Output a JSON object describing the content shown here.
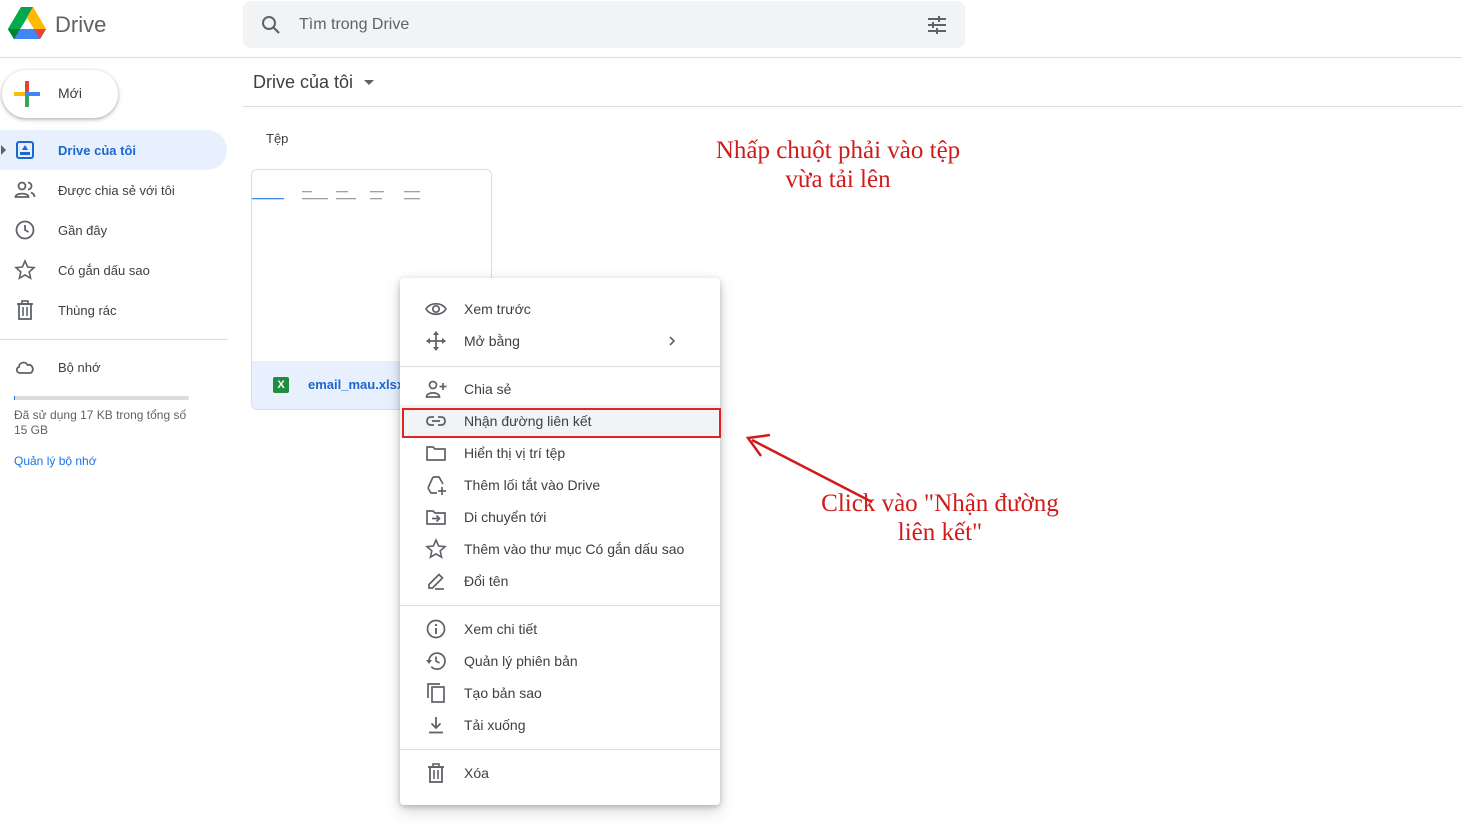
{
  "app": {
    "name": "Drive"
  },
  "search": {
    "placeholder": "Tìm trong Drive"
  },
  "sidebar": {
    "new_label": "Mới",
    "items": [
      {
        "label": "Drive của tôi",
        "icon": "my-drive-icon",
        "active": true
      },
      {
        "label": "Được chia sẻ với tôi",
        "icon": "shared-people-icon",
        "active": false
      },
      {
        "label": "Gần đây",
        "icon": "clock-icon",
        "active": false
      },
      {
        "label": "Có gắn dấu sao",
        "icon": "star-icon",
        "active": false
      },
      {
        "label": "Thùng rác",
        "icon": "trash-icon",
        "active": false
      }
    ],
    "storage": {
      "label": "Bộ nhớ",
      "used_fraction": 0.001,
      "usage_text": "Đã sử dụng 17 KB trong tổng số 15 GB",
      "manage_link": "Quản lý bộ nhớ"
    }
  },
  "main": {
    "breadcrumb": "Drive của tôi",
    "section_label": "Tệp",
    "file": {
      "name": "email_mau.xlsx",
      "type_badge": "X"
    }
  },
  "context_menu": {
    "groups": [
      [
        {
          "label": "Xem trước",
          "icon": "eye-icon"
        },
        {
          "label": "Mở bằng",
          "icon": "move-arrows-icon",
          "submenu": true
        }
      ],
      [
        {
          "label": "Chia sẻ",
          "icon": "add-person-icon"
        },
        {
          "label": "Nhận đường liên kết",
          "icon": "link-icon",
          "highlighted": true
        },
        {
          "label": "Hiển thị vị trí tệp",
          "icon": "folder-icon"
        },
        {
          "label": "Thêm lối tắt vào Drive",
          "icon": "add-shortcut-icon"
        },
        {
          "label": "Di chuyển tới",
          "icon": "move-to-folder-icon"
        },
        {
          "label": "Thêm vào thư mục Có gắn dấu sao",
          "icon": "star-icon"
        },
        {
          "label": "Đổi tên",
          "icon": "pencil-icon"
        }
      ],
      [
        {
          "label": "Xem chi tiết",
          "icon": "info-icon"
        },
        {
          "label": "Quản lý phiên bản",
          "icon": "history-icon"
        },
        {
          "label": "Tạo bản sao",
          "icon": "copy-icon"
        },
        {
          "label": "Tải xuống",
          "icon": "download-icon"
        }
      ],
      [
        {
          "label": "Xóa",
          "icon": "trash-icon"
        }
      ]
    ]
  },
  "annotations": {
    "note1": "Nhấp chuột phải vào tệp vừa tải lên",
    "note2": "Click vào \"Nhận đường liên kết\"",
    "color": "#d11b1b"
  },
  "colors": {
    "accent": "#1a73e8",
    "active_bg": "#e8f0fe",
    "excel_green": "#1e8e3e"
  }
}
